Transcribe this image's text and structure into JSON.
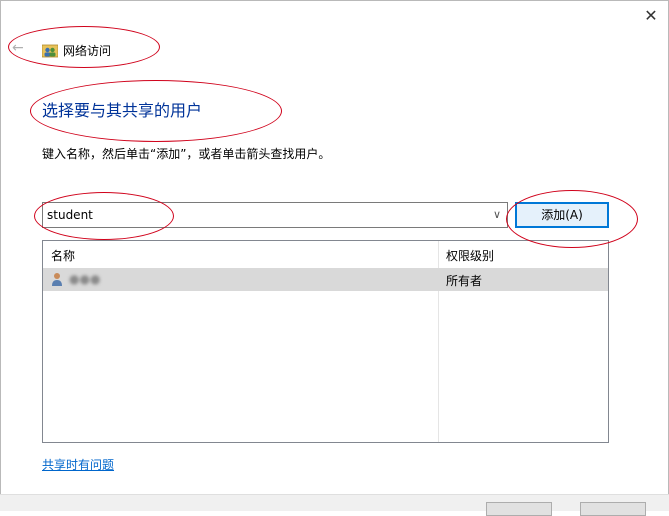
{
  "window": {
    "close_glyph": "✕",
    "back_glyph": "←"
  },
  "wizard": {
    "title": "网络访问"
  },
  "main": {
    "heading": "选择要与其共享的用户",
    "instructions": "键入名称，然后单击“添加”，或者单击箭头查找用户。"
  },
  "user_input": {
    "value": "student",
    "dropdown_glyph": "∨"
  },
  "add_button": {
    "label": "添加(A)"
  },
  "users_table": {
    "columns": [
      "名称",
      "权限级别"
    ],
    "rows": [
      {
        "name": "●●●",
        "permission": "所有者",
        "selected": true
      }
    ]
  },
  "help_link": {
    "label": "共享时有问题"
  },
  "colors": {
    "heading": "#003399",
    "link": "#0066cc",
    "annotation": "#d0021b",
    "selection": "#d9d9d9"
  },
  "icons": {
    "wizard": "network-users-icon",
    "user": "user-icon",
    "close": "close-icon",
    "back": "back-arrow-icon",
    "dropdown": "chevron-down-icon"
  }
}
